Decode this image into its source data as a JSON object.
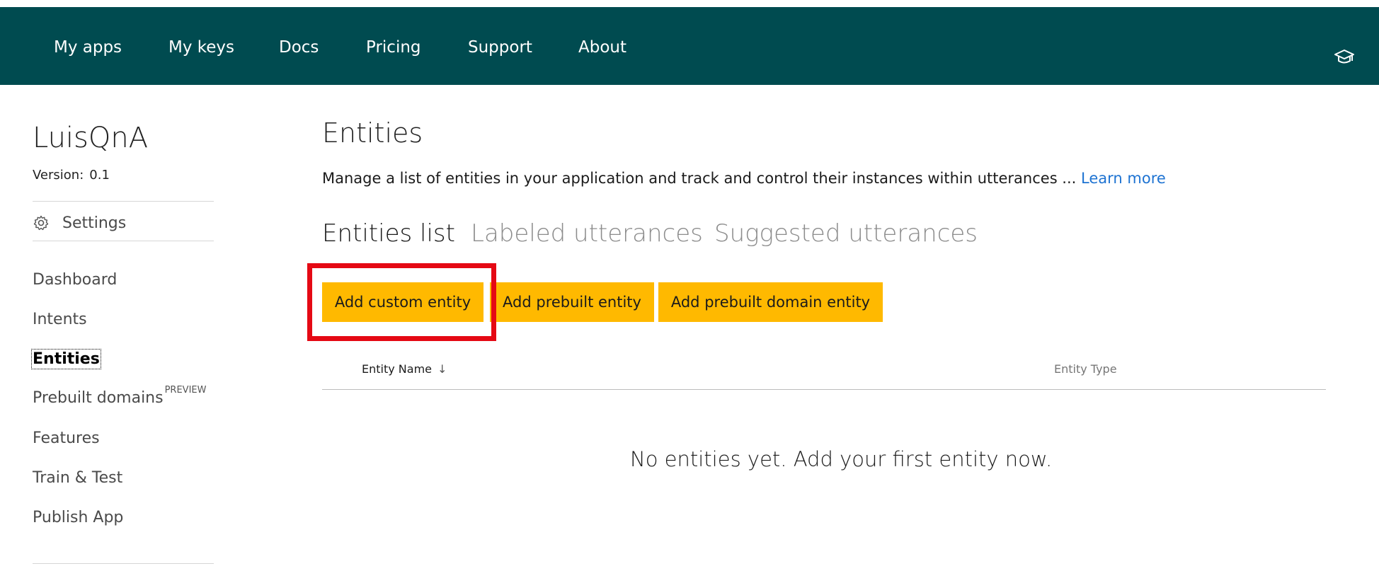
{
  "nav": {
    "items": [
      "My apps",
      "My keys",
      "Docs",
      "Pricing",
      "Support",
      "About"
    ]
  },
  "sidebar": {
    "app_name": "LuisQnA",
    "version_label": "Version:",
    "version_value": "0.1",
    "settings_label": "Settings",
    "items": [
      {
        "label": "Dashboard"
      },
      {
        "label": "Intents"
      },
      {
        "label": "Entities"
      },
      {
        "label": "Prebuilt domains",
        "badge": "PREVIEW"
      },
      {
        "label": "Features"
      },
      {
        "label": "Train & Test"
      },
      {
        "label": "Publish App"
      }
    ]
  },
  "main": {
    "title": "Entities",
    "description": "Manage a list of entities in your application and track and control their instances within utterances ...",
    "learn_more": "Learn more",
    "tabs": [
      "Entities list",
      "Labeled utterances",
      "Suggested utterances"
    ],
    "buttons": {
      "add_custom": "Add custom entity",
      "add_prebuilt": "Add prebuilt entity",
      "add_domain": "Add prebuilt domain entity"
    },
    "table": {
      "columns": [
        "Entity Name",
        "Entity Type"
      ],
      "sort_glyph": "↓",
      "empty_message": "No entities yet. Add your first entity now."
    }
  },
  "colors": {
    "topbar": "#004b50",
    "button": "#ffb900",
    "highlight": "#e50914",
    "link": "#1e73d2"
  },
  "icons": {
    "topbar_right": "graduation-cap-icon",
    "settings": "gear-icon",
    "sort": "sort-down-arrow-icon"
  }
}
